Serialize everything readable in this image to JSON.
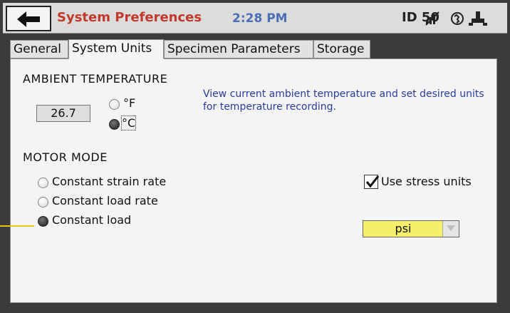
{
  "header": {
    "title": "System Preferences",
    "time": "2:28 PM",
    "device_id": "ID 50",
    "back_icon": "arrow-left-icon",
    "status_icons": [
      "network-off-icon",
      "globe-icon",
      "usb-icon"
    ]
  },
  "tabs": [
    {
      "label": "General",
      "active": false
    },
    {
      "label": "System Units",
      "active": true
    },
    {
      "label": "Specimen Parameters",
      "active": false
    },
    {
      "label": "Storage",
      "active": false
    }
  ],
  "ambient": {
    "heading": "AMBIENT TEMPERATURE",
    "value": "26.7",
    "unit_options": [
      {
        "label": "°F",
        "selected": false
      },
      {
        "label": "°C",
        "selected": true
      }
    ],
    "help": "View current ambient temperature and set desired units for temperature recording."
  },
  "motor": {
    "heading": "MOTOR MODE",
    "options": [
      {
        "label": "Constant strain rate",
        "selected": false
      },
      {
        "label": "Constant load rate",
        "selected": false
      },
      {
        "label": "Constant load",
        "selected": true
      }
    ]
  },
  "stress": {
    "checkbox_label": "Use stress units",
    "checked": true,
    "unit_value": "psi"
  },
  "colors": {
    "title": "#c0392b",
    "clock": "#4a6fb5",
    "help_text": "#2a3d9c",
    "dropdown_bg": "#f5ef6a",
    "callout_line": "#e6c619"
  }
}
